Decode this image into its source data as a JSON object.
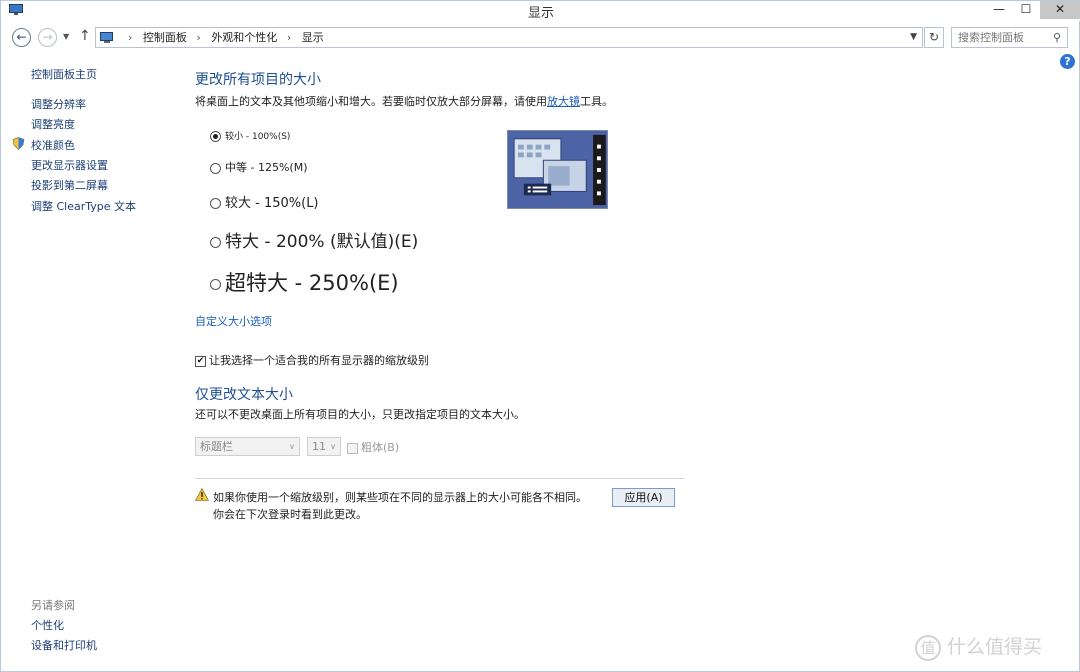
{
  "window": {
    "title": "显示",
    "controls": {
      "minimize": "—",
      "maximize": "☐",
      "close": "✕"
    }
  },
  "address_bar": {
    "crumbs": [
      "控制面板",
      "外观和个性化",
      "显示"
    ],
    "separator": "›",
    "search_placeholder": "搜索控制面板"
  },
  "sidebar": {
    "home": "控制面板主页",
    "items": [
      "调整分辨率",
      "调整亮度",
      "校准颜色",
      "更改显示器设置",
      "投影到第二屏幕",
      "调整 ClearType 文本"
    ],
    "see_also_title": "另请参阅",
    "see_also": [
      "个性化",
      "设备和打印机"
    ]
  },
  "main": {
    "heading": "更改所有项目的大小",
    "description_prefix": "将桌面上的文本及其他项缩小和增大。若要临时仅放大部分屏幕，请使用",
    "description_link": "放大镜",
    "description_suffix": "工具。",
    "size_options": [
      {
        "label": "较小 - 100%(S)",
        "checked": true
      },
      {
        "label": "中等 - 125%(M)",
        "checked": false
      },
      {
        "label": "较大 - 150%(L)",
        "checked": false
      },
      {
        "label": "特大 - 200% (默认值)(E)",
        "checked": false
      },
      {
        "label": "超特大 - 250%(E)",
        "checked": false
      }
    ],
    "custom_link": "自定义大小选项",
    "scaling_checkbox": {
      "label": "让我选择一个适合我的所有显示器的缩放级别",
      "checked": true
    },
    "text_only_heading": "仅更改文本大小",
    "text_only_description": "还可以不更改桌面上所有项目的大小，只更改指定项目的文本大小。",
    "item_select": "标题栏",
    "size_select": "11",
    "bold_label": "粗体(B)",
    "bold_checked": false,
    "warning_line1": "如果你使用一个缩放级别，则某些项在不同的显示器上的大小可能各不相同。",
    "warning_line2": "你会在下次登录时看到此更改。",
    "apply_button": "应用(A)"
  },
  "watermark": "什么值得买",
  "watermark_badge": "值",
  "colors": {
    "heading": "#1d4f91",
    "link": "#1a5fb4",
    "nav_link": "#1c3f75",
    "preview_bg": "#4c63a6",
    "help": "#2b74d6"
  }
}
